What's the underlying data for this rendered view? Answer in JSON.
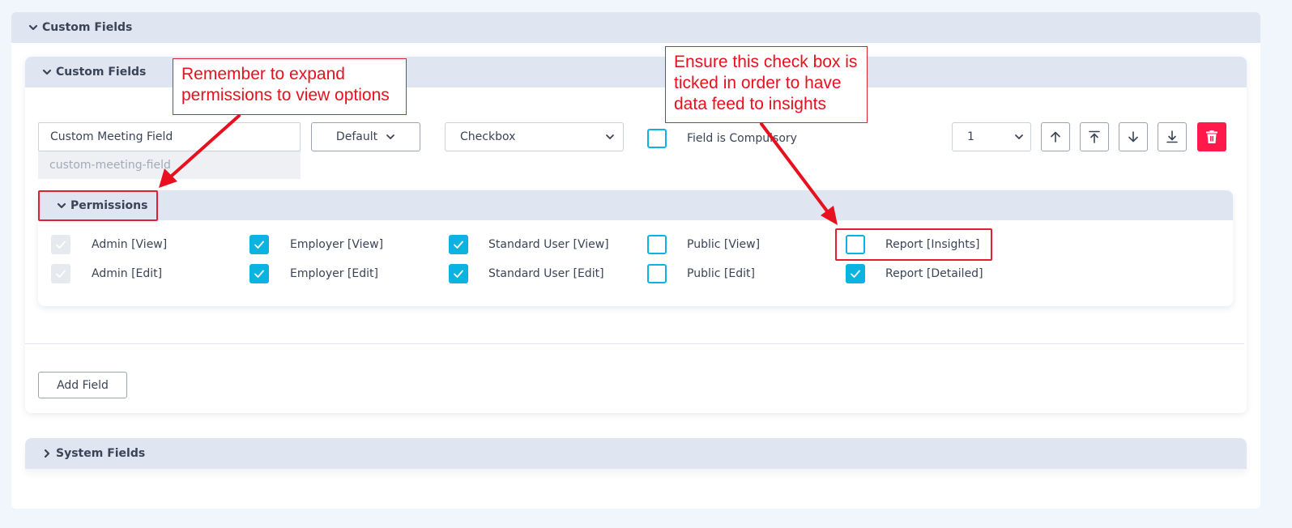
{
  "outer": {
    "title": "Custom Fields"
  },
  "inner": {
    "title": "Custom Fields"
  },
  "field": {
    "name": "Custom Meeting Field",
    "slug": "custom-meeting-field",
    "default_label": "Default",
    "type": "Checkbox",
    "compulsory_label": "Field is Compulsory",
    "compulsory_checked": false,
    "order": "1"
  },
  "permissions": {
    "title": "Permissions",
    "view_row": [
      {
        "label": "Admin [View]",
        "state": "disabled-checked"
      },
      {
        "label": "Employer [View]",
        "state": "checked"
      },
      {
        "label": "Standard User [View]",
        "state": "checked"
      },
      {
        "label": "Public [View]",
        "state": "unchecked"
      },
      {
        "label": "Report [Insights]",
        "state": "unchecked"
      }
    ],
    "edit_row": [
      {
        "label": "Admin [Edit]",
        "state": "disabled-checked"
      },
      {
        "label": "Employer [Edit]",
        "state": "checked"
      },
      {
        "label": "Standard User [Edit]",
        "state": "checked"
      },
      {
        "label": "Public [Edit]",
        "state": "unchecked"
      },
      {
        "label": "Report [Detailed]",
        "state": "checked"
      }
    ]
  },
  "actions": {
    "add_field": "Add Field"
  },
  "system": {
    "title": "System Fields"
  },
  "annotations": {
    "left": "Remember to expand\npermissions to view options",
    "right": "Ensure this check box is\nticked in order to have\ndata feed to insights"
  },
  "colors": {
    "accent": "#0ab3e0",
    "danger": "#ff1a4b",
    "annotation": "#e02030",
    "header_bg": "#dfe6f2"
  },
  "icons": {
    "move_up": "arrow-up-icon",
    "move_top": "arrow-to-top-icon",
    "move_down": "arrow-down-icon",
    "move_bottom": "arrow-to-bottom-icon",
    "delete": "trash-icon"
  }
}
